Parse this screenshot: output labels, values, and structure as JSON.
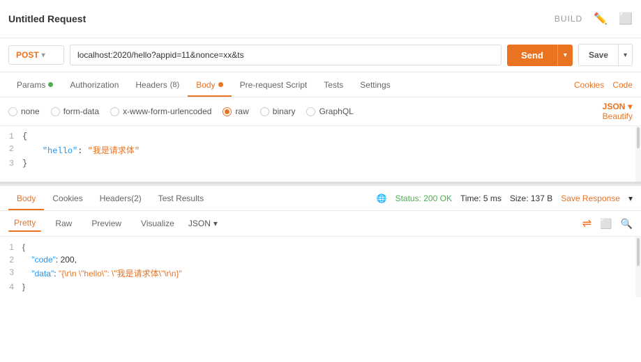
{
  "title": "Untitled Request",
  "build_label": "BUILD",
  "url_bar": {
    "method": "POST",
    "url": "localhost:2020/hello?appid=11&nonce=xx&ts",
    "send_label": "Send",
    "save_label": "Save"
  },
  "req_tabs": {
    "tabs": [
      {
        "id": "params",
        "label": "Params",
        "dot": "green",
        "active": false
      },
      {
        "id": "authorization",
        "label": "Authorization",
        "active": false
      },
      {
        "id": "headers",
        "label": "Headers",
        "badge": "(8)",
        "active": false
      },
      {
        "id": "body",
        "label": "Body",
        "dot": "green",
        "active": true
      },
      {
        "id": "pre-request",
        "label": "Pre-request Script",
        "active": false
      },
      {
        "id": "tests",
        "label": "Tests",
        "active": false
      },
      {
        "id": "settings",
        "label": "Settings",
        "active": false
      }
    ],
    "right_links": [
      "Cookies",
      "Code"
    ]
  },
  "format_bar": {
    "options": [
      {
        "id": "none",
        "label": "none",
        "checked": false
      },
      {
        "id": "form-data",
        "label": "form-data",
        "checked": false
      },
      {
        "id": "x-www-form-urlencoded",
        "label": "x-www-form-urlencoded",
        "checked": false
      },
      {
        "id": "raw",
        "label": "raw",
        "checked": true
      },
      {
        "id": "binary",
        "label": "binary",
        "checked": false
      },
      {
        "id": "graphql",
        "label": "GraphQL",
        "checked": false
      }
    ],
    "json_label": "JSON",
    "beautify_label": "Beautify"
  },
  "editor": {
    "lines": [
      {
        "num": "1",
        "content": "{"
      },
      {
        "num": "2",
        "key": "\"hello\"",
        "colon": ": ",
        "value": "\"我是请求体\""
      },
      {
        "num": "3",
        "content": "}"
      }
    ]
  },
  "response_header": {
    "tabs": [
      {
        "id": "body",
        "label": "Body",
        "active": true
      },
      {
        "id": "cookies",
        "label": "Cookies",
        "active": false
      },
      {
        "id": "headers",
        "label": "Headers",
        "badge": "(2)",
        "active": false
      },
      {
        "id": "test-results",
        "label": "Test Results",
        "active": false
      }
    ],
    "status": "Status: 200 OK",
    "time": "Time: 5 ms",
    "size": "Size: 137 B",
    "save_response": "Save Response"
  },
  "res_format_bar": {
    "tabs": [
      {
        "id": "pretty",
        "label": "Pretty",
        "active": true
      },
      {
        "id": "raw",
        "label": "Raw",
        "active": false
      },
      {
        "id": "preview",
        "label": "Preview",
        "active": false
      },
      {
        "id": "visualize",
        "label": "Visualize",
        "active": false
      }
    ],
    "json_label": "JSON"
  },
  "res_editor": {
    "lines": [
      {
        "num": "1",
        "content": "{"
      },
      {
        "num": "2",
        "key": "\"code\"",
        "colon": ": ",
        "value": "200,"
      },
      {
        "num": "3",
        "key": "\"data\"",
        "colon": ": ",
        "value": "\"{\\r\\n    \\\"hello\\\": \\\"我是请求体\\\"\\r\\n}\""
      },
      {
        "num": "4",
        "content": "}"
      }
    ]
  }
}
